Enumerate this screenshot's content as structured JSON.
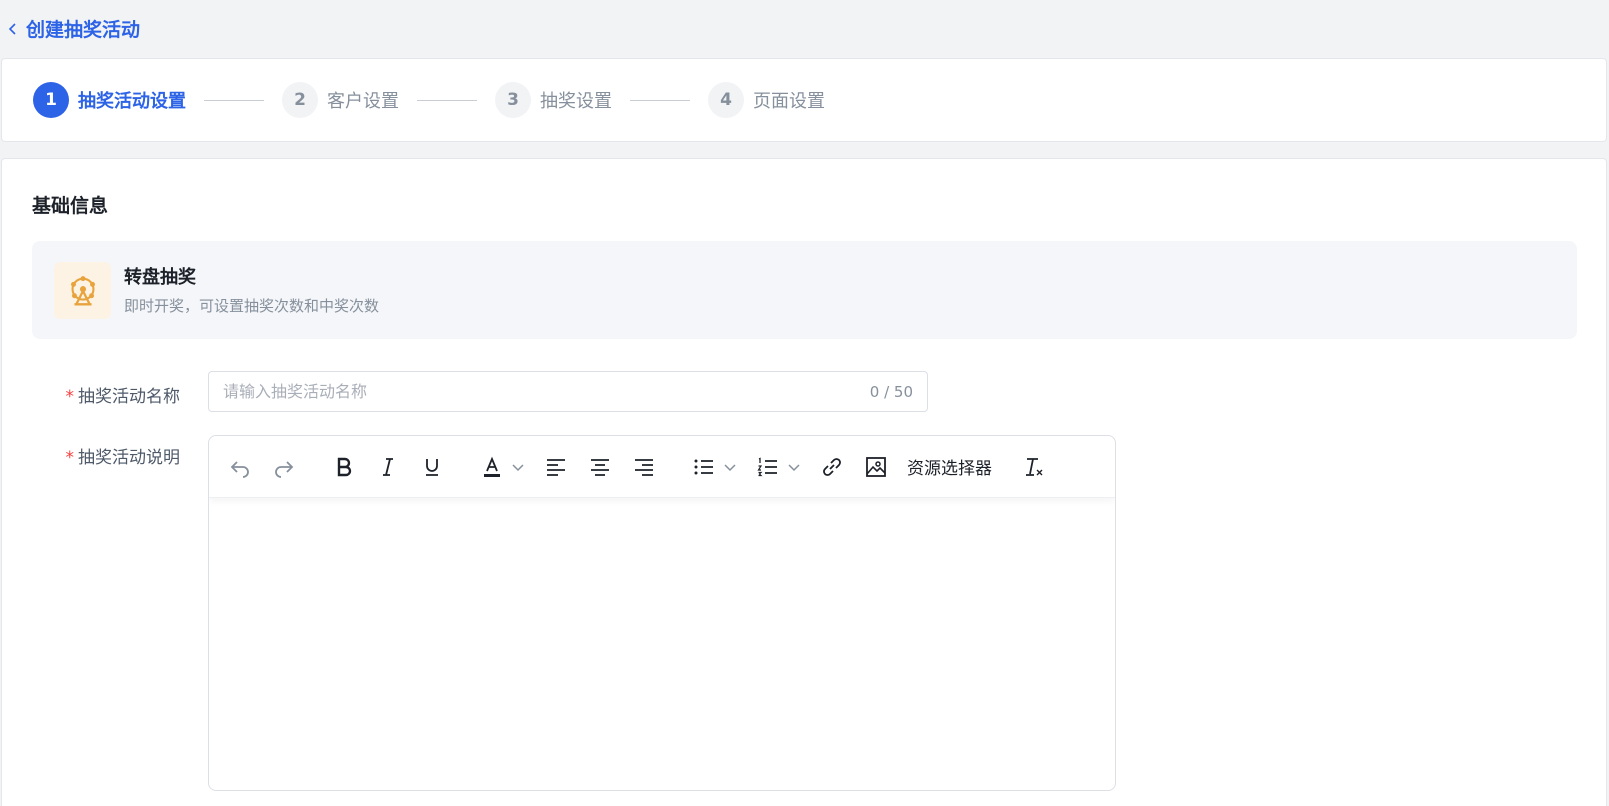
{
  "header": {
    "title": "创建抽奖活动"
  },
  "steps": [
    {
      "num": "1",
      "label": "抽奖活动设置",
      "active": true
    },
    {
      "num": "2",
      "label": "客户设置",
      "active": false
    },
    {
      "num": "3",
      "label": "抽奖设置",
      "active": false
    },
    {
      "num": "4",
      "label": "页面设置",
      "active": false
    }
  ],
  "basic": {
    "section_title": "基础信息",
    "type_name": "转盘抽奖",
    "type_desc": "即时开奖，可设置抽奖次数和中奖次数",
    "type_icon": "ferris-wheel-icon"
  },
  "form": {
    "name_label": "抽奖活动名称",
    "name_placeholder": "请输入抽奖活动名称",
    "name_value": "",
    "name_counter": "0 / 50",
    "desc_label": "抽奖活动说明",
    "required_mark": "*"
  },
  "toolbar": {
    "resource_picker": "资源选择器",
    "icons": [
      "undo-icon",
      "redo-icon",
      "bold-icon",
      "italic-icon",
      "underline-icon",
      "font-color-icon",
      "align-left-icon",
      "align-center-icon",
      "align-right-icon",
      "bullet-list-icon",
      "numbered-list-icon",
      "link-icon",
      "image-icon",
      "clear-format-icon"
    ]
  },
  "colors": {
    "accent": "#2d63e6",
    "required": "#f53f3f",
    "icon_orange": "#e8a33d"
  }
}
